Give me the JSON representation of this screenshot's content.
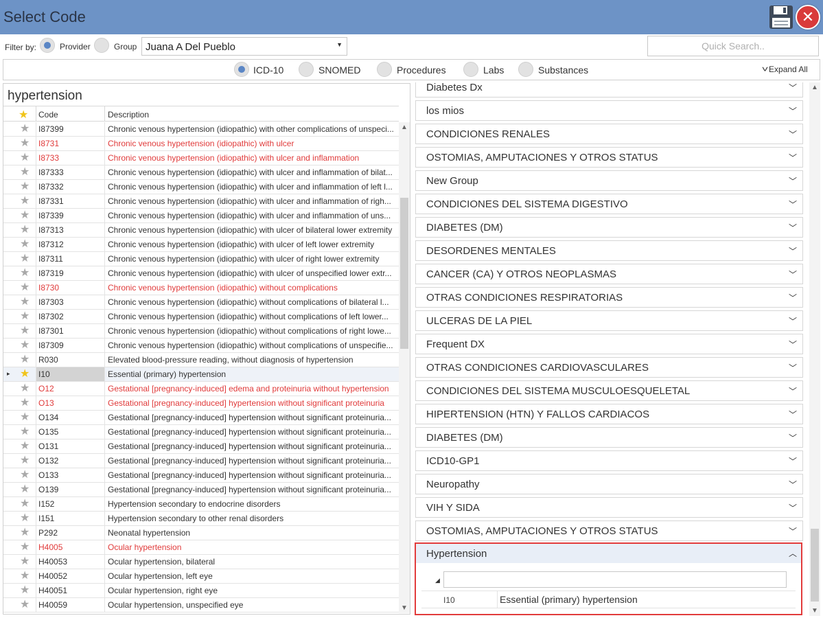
{
  "window": {
    "title": "Select Code"
  },
  "filter": {
    "label": "Filter by:",
    "provider_label": "Provider",
    "group_label": "Group",
    "selected": "provider",
    "provider_value": "Juana A Del Pueblo",
    "quick_search_placeholder": "Quick Search.."
  },
  "code_types": {
    "options": [
      "ICD-10",
      "SNOMED",
      "Procedures",
      "Labs",
      "Substances"
    ],
    "selected": "ICD-10",
    "expand_all_label": "Expand All"
  },
  "search_term": "hypertension",
  "grid": {
    "columns": {
      "code": "Code",
      "description": "Description"
    },
    "rows": [
      {
        "code": "I87399",
        "description": "Chronic venous hypertension (idiopathic) with other complications of unspeci...",
        "favorite": false,
        "red": false
      },
      {
        "code": "I8731",
        "description": "Chronic venous hypertension (idiopathic) with ulcer",
        "favorite": false,
        "red": true
      },
      {
        "code": "I8733",
        "description": "Chronic venous hypertension (idiopathic) with ulcer and inflammation",
        "favorite": false,
        "red": true
      },
      {
        "code": "I87333",
        "description": "Chronic venous hypertension (idiopathic) with ulcer and inflammation of bilat...",
        "favorite": false,
        "red": false
      },
      {
        "code": "I87332",
        "description": "Chronic venous hypertension (idiopathic) with ulcer and inflammation of left l...",
        "favorite": false,
        "red": false
      },
      {
        "code": "I87331",
        "description": "Chronic venous hypertension (idiopathic) with ulcer and inflammation of righ...",
        "favorite": false,
        "red": false
      },
      {
        "code": "I87339",
        "description": "Chronic venous hypertension (idiopathic) with ulcer and inflammation of uns...",
        "favorite": false,
        "red": false
      },
      {
        "code": "I87313",
        "description": "Chronic venous hypertension (idiopathic) with ulcer of bilateral lower extremity",
        "favorite": false,
        "red": false
      },
      {
        "code": "I87312",
        "description": "Chronic venous hypertension (idiopathic) with ulcer of left lower extremity",
        "favorite": false,
        "red": false
      },
      {
        "code": "I87311",
        "description": "Chronic venous hypertension (idiopathic) with ulcer of right lower extremity",
        "favorite": false,
        "red": false
      },
      {
        "code": "I87319",
        "description": "Chronic venous hypertension (idiopathic) with ulcer of unspecified lower extr...",
        "favorite": false,
        "red": false
      },
      {
        "code": "I8730",
        "description": "Chronic venous hypertension (idiopathic) without complications",
        "favorite": false,
        "red": true
      },
      {
        "code": "I87303",
        "description": "Chronic venous hypertension (idiopathic) without complications of bilateral l...",
        "favorite": false,
        "red": false
      },
      {
        "code": "I87302",
        "description": "Chronic venous hypertension (idiopathic) without complications of left lower...",
        "favorite": false,
        "red": false
      },
      {
        "code": "I87301",
        "description": "Chronic venous hypertension (idiopathic) without complications of right lowe...",
        "favorite": false,
        "red": false
      },
      {
        "code": "I87309",
        "description": "Chronic venous hypertension (idiopathic) without complications of unspecifie...",
        "favorite": false,
        "red": false
      },
      {
        "code": "R030",
        "description": "Elevated blood-pressure reading, without diagnosis of hypertension",
        "favorite": false,
        "red": false
      },
      {
        "code": "I10",
        "description": "Essential (primary) hypertension",
        "favorite": true,
        "red": false,
        "selected": true
      },
      {
        "code": "O12",
        "description": "Gestational [pregnancy-induced] edema and proteinuria without hypertension",
        "favorite": false,
        "red": true
      },
      {
        "code": "O13",
        "description": "Gestational [pregnancy-induced] hypertension without significant proteinuria",
        "favorite": false,
        "red": true
      },
      {
        "code": "O134",
        "description": "Gestational [pregnancy-induced] hypertension without significant proteinuria...",
        "favorite": false,
        "red": false
      },
      {
        "code": "O135",
        "description": "Gestational [pregnancy-induced] hypertension without significant proteinuria...",
        "favorite": false,
        "red": false
      },
      {
        "code": "O131",
        "description": "Gestational [pregnancy-induced] hypertension without significant proteinuria...",
        "favorite": false,
        "red": false
      },
      {
        "code": "O132",
        "description": "Gestational [pregnancy-induced] hypertension without significant proteinuria...",
        "favorite": false,
        "red": false
      },
      {
        "code": "O133",
        "description": "Gestational [pregnancy-induced] hypertension without significant proteinuria...",
        "favorite": false,
        "red": false
      },
      {
        "code": "O139",
        "description": "Gestational [pregnancy-induced] hypertension without significant proteinuria...",
        "favorite": false,
        "red": false
      },
      {
        "code": "I152",
        "description": "Hypertension secondary to endocrine disorders",
        "favorite": false,
        "red": false
      },
      {
        "code": "I151",
        "description": "Hypertension secondary to other renal disorders",
        "favorite": false,
        "red": false
      },
      {
        "code": "P292",
        "description": "Neonatal hypertension",
        "favorite": false,
        "red": false
      },
      {
        "code": "H4005",
        "description": "Ocular hypertension",
        "favorite": false,
        "red": true
      },
      {
        "code": "H40053",
        "description": "Ocular hypertension, bilateral",
        "favorite": false,
        "red": false
      },
      {
        "code": "H40052",
        "description": "Ocular hypertension, left eye",
        "favorite": false,
        "red": false
      },
      {
        "code": "H40051",
        "description": "Ocular hypertension, right eye",
        "favorite": false,
        "red": false
      },
      {
        "code": "H40059",
        "description": "Ocular hypertension, unspecified eye",
        "favorite": false,
        "red": false
      }
    ]
  },
  "groups": [
    "Diabetes Dx",
    "los mios",
    "CONDICIONES RENALES",
    "OSTOMIAS, AMPUTACIONES Y OTROS STATUS",
    "New Group",
    "CONDICIONES DEL SISTEMA DIGESTIVO",
    "DIABETES (DM)",
    "DESORDENES MENTALES",
    "CANCER (CA) Y OTROS NEOPLASMAS",
    "OTRAS CONDICIONES RESPIRATORIAS",
    "ULCERAS DE LA PIEL",
    "Frequent DX",
    "OTRAS CONDICIONES CARDIOVASCULARES",
    "CONDICIONES DEL SISTEMA MUSCULOESQUELETAL",
    "HIPERTENSION (HTN) Y FALLOS CARDIACOS",
    "DIABETES (DM)",
    "ICD10-GP1",
    "Neuropathy",
    "VIH Y SIDA",
    "OSTOMIAS, AMPUTACIONES Y OTROS STATUS"
  ],
  "expanded_group": {
    "name": "Hypertension",
    "items": [
      {
        "code": "I10",
        "description": "Essential (primary) hypertension"
      }
    ]
  },
  "icons": {
    "save": "floppy-disk-icon",
    "close": "close-icon",
    "favorite": "star-icon",
    "expand": "chevron-down-icon",
    "collapse": "chevron-up-icon"
  },
  "colors": {
    "titlebar": "#6d93c6",
    "radio_selected": "#5b86c5",
    "favorite_star": "#f0c419",
    "red_text": "#e03a3a",
    "highlight_border": "#e23b3b"
  }
}
